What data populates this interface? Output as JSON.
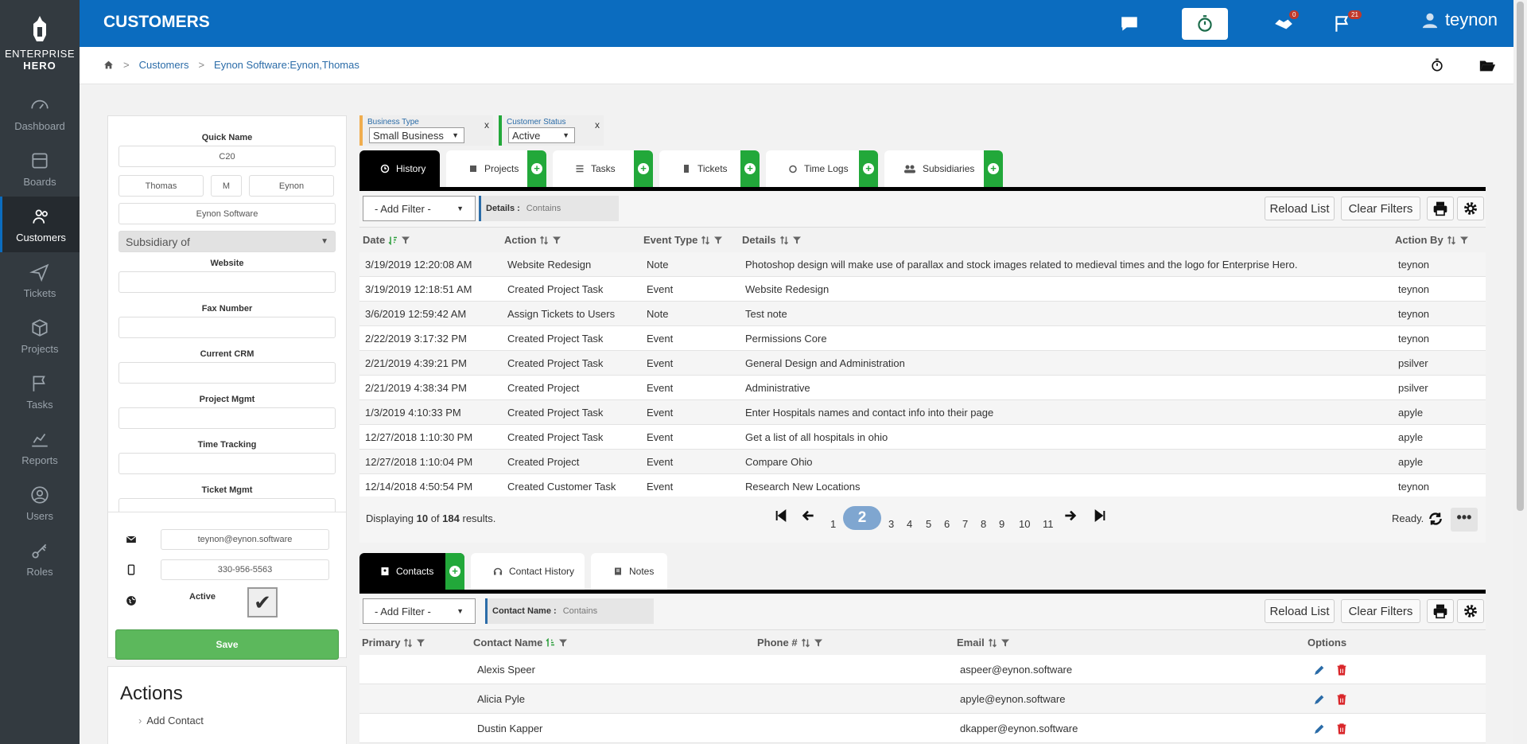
{
  "brand": {
    "line1": "ENTERPRISE",
    "line2": "HERO"
  },
  "nav": [
    {
      "label": "Dashboard",
      "icon": "dashboard-icon"
    },
    {
      "label": "Boards",
      "icon": "boards-icon"
    },
    {
      "label": "Customers",
      "icon": "customers-icon",
      "active": true
    },
    {
      "label": "Tickets",
      "icon": "tickets-icon"
    },
    {
      "label": "Projects",
      "icon": "projects-icon"
    },
    {
      "label": "Tasks",
      "icon": "tasks-icon"
    },
    {
      "label": "Reports",
      "icon": "reports-icon"
    },
    {
      "label": "Users",
      "icon": "users-icon"
    },
    {
      "label": "Roles",
      "icon": "roles-icon"
    }
  ],
  "header": {
    "title": "CUSTOMERS",
    "user": "teynon",
    "badges": {
      "reviews": "0",
      "flags": "21"
    }
  },
  "breadcrumb": {
    "items": [
      "Customers",
      "Eynon Software:Eynon,Thomas"
    ]
  },
  "form": {
    "quick_name_label": "Quick Name",
    "quick_name": "C20",
    "first": "Thomas",
    "middle": "M",
    "last": "Eynon",
    "company": "Eynon Software",
    "subsidiary": "Subsidiary of",
    "website_label": "Website",
    "fax_label": "Fax Number",
    "crm_label": "Current CRM",
    "pm_label": "Project Mgmt",
    "tt_label": "Time Tracking",
    "tm_label": "Ticket Mgmt",
    "email": "teynon@eynon.software",
    "phone": "330-956-5563",
    "active_label": "Active",
    "save": "Save",
    "actions_title": "Actions",
    "add_contact": "Add Contact"
  },
  "filters": [
    {
      "label": "Business Type",
      "value": "Small Business",
      "color": "#f0ad4e"
    },
    {
      "label": "Customer Status",
      "value": "Active",
      "color": "#22a83a"
    }
  ],
  "tabs": [
    {
      "label": "History",
      "active": true,
      "plus": false
    },
    {
      "label": "Projects",
      "plus": true
    },
    {
      "label": "Tasks",
      "plus": true
    },
    {
      "label": "Tickets",
      "plus": true
    },
    {
      "label": "Time Logs",
      "plus": true
    },
    {
      "label": "Subsidiaries",
      "plus": true
    }
  ],
  "toolbar": {
    "add_filter": "- Add Filter -",
    "detail_label": "Details :",
    "detail_op": "Contains",
    "reload": "Reload List",
    "clear": "Clear Filters"
  },
  "history": {
    "columns": [
      "Date",
      "Action",
      "Event Type",
      "Details",
      "Action By"
    ],
    "rows": [
      [
        "3/19/2019 12:20:08 AM",
        "Website Redesign",
        "Note",
        "Photoshop design will make use of parallax and stock images related to medieval times and the logo for Enterprise Hero.",
        "teynon"
      ],
      [
        "3/19/2019 12:18:51 AM",
        "Created Project Task",
        "Event",
        "Website Redesign",
        "teynon"
      ],
      [
        "3/6/2019 12:59:42 AM",
        "Assign Tickets to Users",
        "Note",
        "Test note",
        "teynon"
      ],
      [
        "2/22/2019 3:17:32 PM",
        "Created Project Task",
        "Event",
        "Permissions Core",
        "teynon"
      ],
      [
        "2/21/2019 4:39:21 PM",
        "Created Project Task",
        "Event",
        "General Design and Administration",
        "psilver"
      ],
      [
        "2/21/2019 4:38:34 PM",
        "Created Project",
        "Event",
        "Administrative",
        "psilver"
      ],
      [
        "1/3/2019 4:10:33 PM",
        "Created Project Task",
        "Event",
        "Enter Hospitals names and contact info into their page",
        "apyle"
      ],
      [
        "12/27/2018 1:10:30 PM",
        "Created Project Task",
        "Event",
        "Get a list of all hospitals in ohio",
        "apyle"
      ],
      [
        "12/27/2018 1:10:04 PM",
        "Created Project",
        "Event",
        "Compare Ohio",
        "apyle"
      ],
      [
        "12/14/2018 4:50:54 PM",
        "Created Customer Task",
        "Event",
        "Research New Locations",
        "teynon"
      ]
    ],
    "display_pre": "Displaying",
    "shown": "10",
    "display_mid": "of",
    "total": "184",
    "display_post": "results.",
    "pages": [
      "1",
      "2",
      "3",
      "4",
      "5",
      "6",
      "7",
      "8",
      "9",
      "10",
      "11"
    ],
    "current_page": "2",
    "status": "Ready."
  },
  "tabs2": [
    {
      "label": "Contacts",
      "active": true,
      "plus": true
    },
    {
      "label": "Contact History"
    },
    {
      "label": "Notes"
    }
  ],
  "contacts": {
    "add_filter": "- Add Filter -",
    "filter_label": "Contact Name :",
    "filter_op": "Contains",
    "reload": "Reload List",
    "clear": "Clear Filters",
    "columns": [
      "Primary",
      "Contact Name",
      "Phone #",
      "Email",
      "Options"
    ],
    "rows": [
      [
        "Alexis Speer",
        "aspeer@eynon.software"
      ],
      [
        "Alicia Pyle",
        "apyle@eynon.software"
      ],
      [
        "Dustin Kapper",
        "dkapper@eynon.software"
      ]
    ]
  }
}
